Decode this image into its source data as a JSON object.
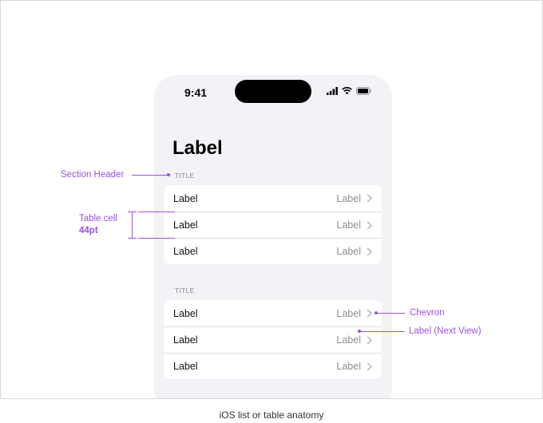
{
  "status_bar": {
    "time": "9:41",
    "icons": [
      "cellular-icon",
      "wifi-icon",
      "battery-icon"
    ]
  },
  "screen": {
    "large_title": "Label",
    "sections": [
      {
        "title": "TITLE",
        "rows": [
          {
            "label": "Label",
            "value": "Label"
          },
          {
            "label": "Label",
            "value": "Label"
          },
          {
            "label": "Label",
            "value": "Label"
          }
        ]
      },
      {
        "title": "TITLE",
        "rows": [
          {
            "label": "Label",
            "value": "Label"
          },
          {
            "label": "Label",
            "value": "Label"
          },
          {
            "label": "Label",
            "value": "Label"
          }
        ]
      }
    ]
  },
  "annotations": {
    "section_header": "Section Header",
    "table_cell": "Table cell",
    "table_cell_size": "44pt",
    "chevron": "Chevron",
    "label_next_view": "Label (Next View)"
  },
  "colors": {
    "annotation": "#9b51e0",
    "background": "#f2f2f7"
  },
  "caption": "iOS list or table anatomy"
}
